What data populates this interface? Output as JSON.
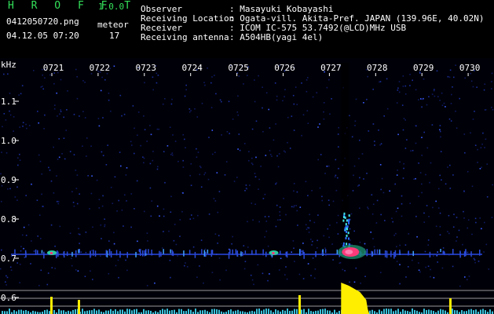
{
  "app": {
    "logo": "H R O F F T",
    "version": "1.0.0"
  },
  "file": {
    "name": "0412050720.png",
    "datetime": "04.12.05 07:20"
  },
  "meteor": {
    "label": "meteor",
    "count": "17"
  },
  "info": [
    {
      "key": "Observer",
      "value": ": Masayuki Kobayashi"
    },
    {
      "key": "Receiving Location",
      "value": ": Ogata-vill. Akita-Pref. JAPAN (139.96E, 40.02N)"
    },
    {
      "key": "Receiver",
      "value": ": ICOM IC-575 53.7492(@LCD)MHz USB"
    },
    {
      "key": "Receiving antenna",
      "value": ": A504HB(yagi 4el)"
    }
  ],
  "colors": {
    "accent": "#33e05a",
    "noise": "#1b2f9a",
    "echo_hot": "#ff3a7a",
    "echo_yellow": "#ffee00",
    "echo_cyan": "#40e8e8"
  },
  "chart_data": {
    "type": "heatmap",
    "yunit": "kHz",
    "x_ticks": [
      "0721",
      "0722",
      "0723",
      "0724",
      "0725",
      "0726",
      "0727",
      "0728",
      "0729",
      "0730"
    ],
    "y_ticks": [
      "1.1",
      "1.0",
      "0.9",
      "0.8",
      "0.7",
      "0.6"
    ],
    "ylim": [
      0.57,
      1.19
    ],
    "baseline_khz": 0.71,
    "strong_echo": {
      "time": "0728",
      "peak_khz": 0.71,
      "top_khz": 0.82
    },
    "minor_echoes": [
      "0721",
      "0726"
    ]
  }
}
